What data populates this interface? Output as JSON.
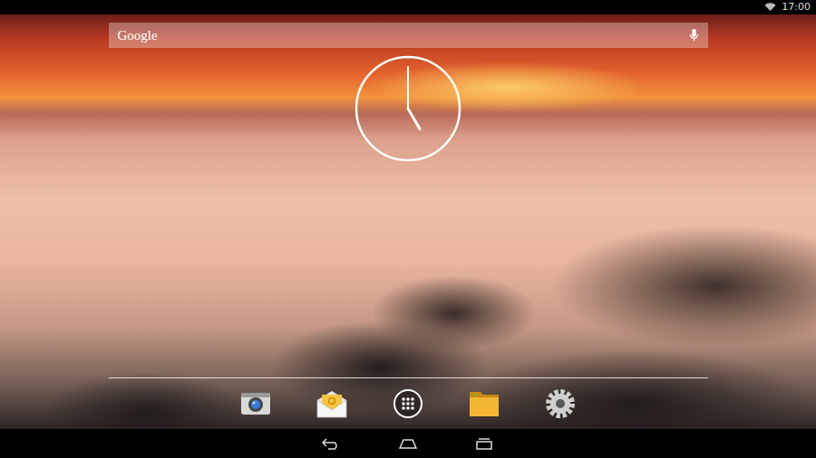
{
  "status_bar": {
    "time": "17:00",
    "wifi": true
  },
  "search": {
    "placeholder": "Google"
  },
  "clock": {
    "hour": 5,
    "minute": 0
  },
  "dock": [
    {
      "kind": "camera"
    },
    {
      "kind": "email"
    },
    {
      "kind": "apps"
    },
    {
      "kind": "files"
    },
    {
      "kind": "settings"
    }
  ],
  "nav": [
    {
      "kind": "back"
    },
    {
      "kind": "home"
    },
    {
      "kind": "recents"
    }
  ]
}
